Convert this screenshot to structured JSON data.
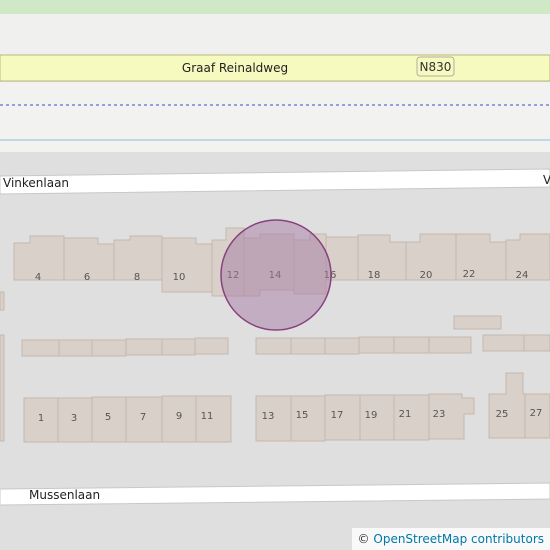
{
  "map": {
    "roads": {
      "main": "Graaf Reinaldweg",
      "main_ref": "N830",
      "upper_street": "Vinkenlaan",
      "upper_street_cut": "V",
      "lower_street": "Mussenlaan"
    },
    "house_numbers_top": [
      "4",
      "6",
      "8",
      "10",
      "12",
      "14",
      "16",
      "18",
      "20",
      "22",
      "24"
    ],
    "house_numbers_bottom": [
      "1",
      "3",
      "5",
      "7",
      "9",
      "11",
      "13",
      "15",
      "17",
      "19",
      "21",
      "23",
      "25",
      "27"
    ]
  },
  "attribution": {
    "symbol": "©",
    "text": "OpenStreetMap contributors"
  },
  "colors": {
    "background": "#e0dfdf",
    "building_fill": "#d9d0c9",
    "building_stroke": "#c4b7ad",
    "primary_road": "#f7fabf",
    "primary_road_casing": "#b9b87a",
    "railway_line": "#3b4ac8",
    "waterway": "#aad3df",
    "marker_fill": "#a67ca6",
    "marker_stroke": "#88417d"
  }
}
